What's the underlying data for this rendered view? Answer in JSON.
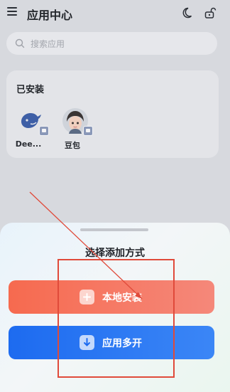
{
  "header": {
    "title": "应用中心",
    "menu_icon": "menu-icon",
    "theme_icon": "moon-icon",
    "lock_icon": "lock-open-icon"
  },
  "search": {
    "placeholder": "搜索应用"
  },
  "installed": {
    "title": "已安装",
    "apps": [
      {
        "label": "Dee...",
        "icon": "deepseek-whale-icon"
      },
      {
        "label": "豆包",
        "icon": "doubao-avatar-icon"
      }
    ]
  },
  "sheet": {
    "title": "选择添加方式",
    "buttons": [
      {
        "label": "本地安装",
        "icon": "plus-icon",
        "color": "#f66a4f"
      },
      {
        "label": "应用多开",
        "icon": "download-icon",
        "color": "#1d6bf0"
      }
    ]
  },
  "annotation": {
    "color": "#e04a3a"
  }
}
